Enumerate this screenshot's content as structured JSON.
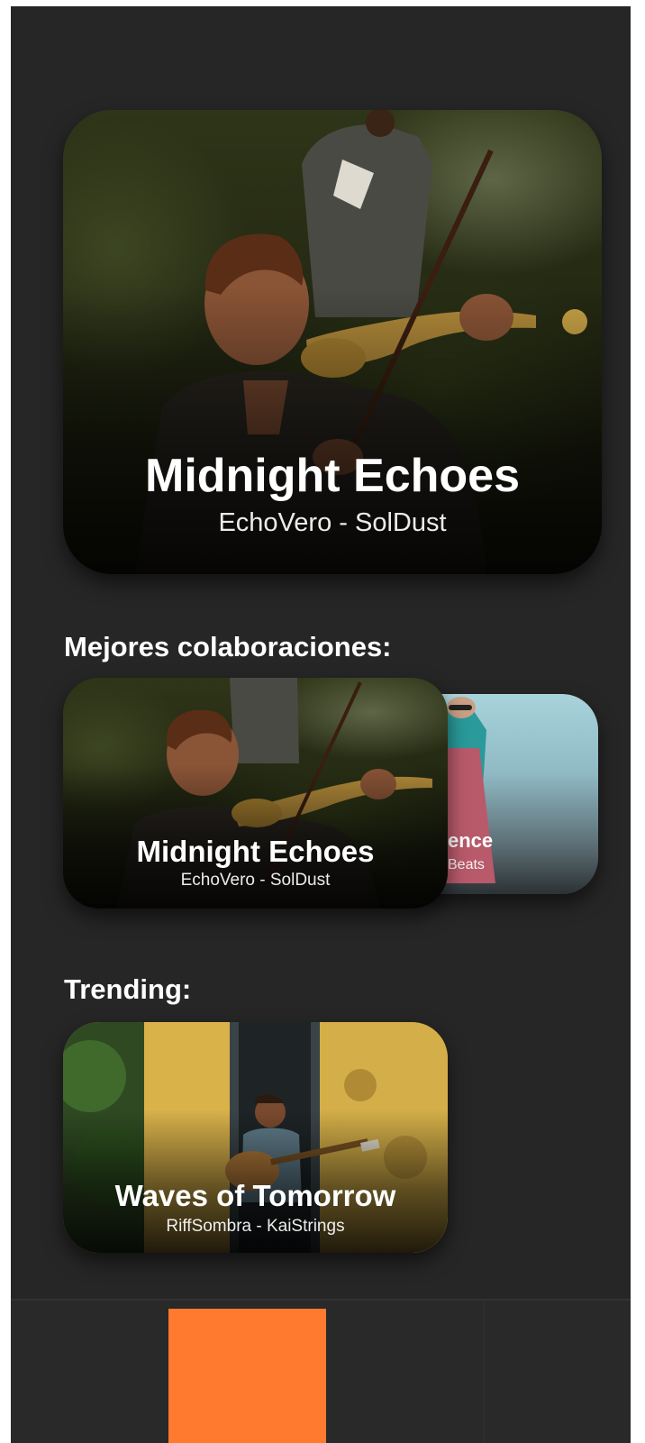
{
  "featured": {
    "title": "Midnight Echoes",
    "artists": "EchoVero - SolDust"
  },
  "collaborations": {
    "heading": "Mejores colaboraciones:",
    "cards": [
      {
        "title": "Midnight Echoes",
        "artists": "EchoVero - SolDust"
      },
      {
        "title": "ence",
        "artists": "Beats"
      }
    ]
  },
  "trending": {
    "heading": "Trending:",
    "cards": [
      {
        "title": "Waves of Tomorrow",
        "artists": "RiffSombra - KaiStrings"
      }
    ]
  },
  "bottom_nav": {
    "active_index": 1,
    "colors": {
      "background": "#292929",
      "active": "#FF7A2F"
    }
  },
  "colors": {
    "background": "#262626",
    "text": "#FFFFFF",
    "accent": "#FF7A2F"
  }
}
